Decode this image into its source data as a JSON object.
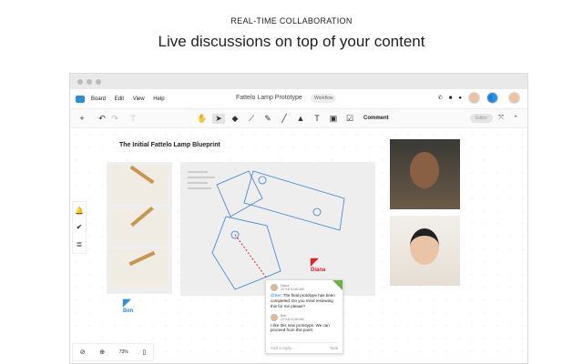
{
  "kicker": "REAL-TIME COLLABORATION",
  "headline": "Live discussions on top of your content",
  "menu": {
    "items": [
      "Board",
      "Edit",
      "View",
      "Help"
    ],
    "doc_title": "Fattelo Lamp Prototype",
    "workflow": "Workflow"
  },
  "toolbar": {
    "comment_label": "Comment",
    "editor_label": "Editor"
  },
  "board": {
    "title": "The Initial Fattelo Lamp Blueprint"
  },
  "cursors": {
    "ben": "Ben",
    "diana": "Diana"
  },
  "comments": [
    {
      "author": "Diana",
      "time": "2/7/18 10:40 AM",
      "mention": "@Ben",
      "text": " The final prototype has been completed. Do you mind reviewing this for me please?"
    },
    {
      "author": "Ben",
      "time": "2/7/18 10:46 AM",
      "text": "I like this new prototype. We can proceed from this point."
    }
  ],
  "reply": {
    "placeholder": "Add a reply...",
    "task": "Task"
  },
  "zoom": "73%",
  "colors": {
    "accent": "#2b8fe0",
    "diana": "#e0202a",
    "ben": "#2b8fe0",
    "resolved": "#6cb33e"
  }
}
